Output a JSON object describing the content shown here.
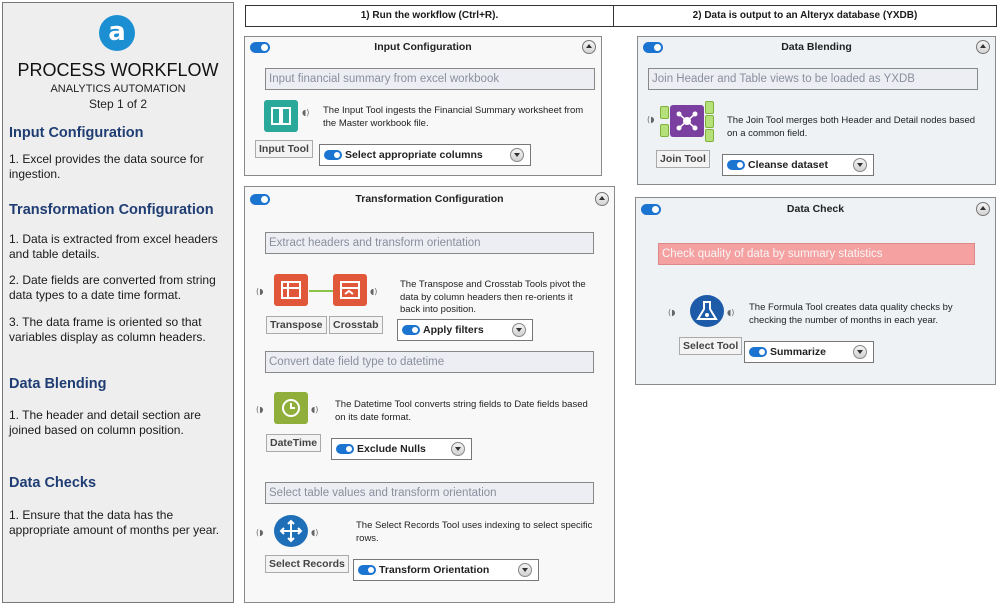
{
  "left_panel": {
    "logo_letter": "a",
    "title": "PROCESS WORKFLOW",
    "subtitle": "ANALYTICS AUTOMATION",
    "step": "Step 1 of 2",
    "sections": [
      {
        "heading": "Input Configuration",
        "items": [
          "1. Excel provides the data source for ingestion."
        ]
      },
      {
        "heading": "Transformation Configuration",
        "items": [
          "1. Data is extracted from excel headers and table details.",
          "2. Date fields are converted from string data types to a date time format.",
          "3. The data frame is oriented so that variables display as column headers."
        ]
      },
      {
        "heading": "Data Blending",
        "items": [
          "1. The header and detail section are joined based on column position."
        ]
      },
      {
        "heading": "Data Checks",
        "items": [
          "1. Ensure that the data has the appropriate amount of months per year."
        ]
      }
    ]
  },
  "steps": {
    "step1": "1) Run the workflow (Ctrl+R).",
    "step2": "2) Data is output to an Alteryx database (YXDB)"
  },
  "input_config": {
    "title": "Input Configuration",
    "banner": "Input financial summary from excel workbook",
    "tool_label": "Input Tool",
    "description": "The Input Tool ingests the Financial Summary worksheet from the Master workbook file.",
    "dropdown": "Select appropriate columns"
  },
  "transformation": {
    "title": "Transformation Configuration",
    "section1": {
      "banner": "Extract headers and transform orientation",
      "tool1_label": "Transpose",
      "tool2_label": "Crosstab",
      "description": "The Transpose and Crosstab Tools pivot the data by column headers then re-orients it back into position.",
      "dropdown": "Apply filters"
    },
    "section2": {
      "banner": "Convert date field type to datetime",
      "tool_label": "DateTime",
      "description": "The Datetime Tool converts string fields to Date fields based on its date format.",
      "dropdown": "Exclude Nulls"
    },
    "section3": {
      "banner": "Select table values and transform orientation",
      "tool_label": "Select Records",
      "description": "The Select Records Tool uses indexing to select specific rows.",
      "dropdown": "Transform Orientation"
    }
  },
  "data_blending": {
    "title": "Data Blending",
    "banner": "Join Header and Table views to be loaded as YXDB",
    "tool_label": "Join Tool",
    "description": "The Join Tool merges both Header and Detail nodes based on a common field.",
    "dropdown": "Cleanse dataset",
    "anchors": [
      "L",
      "J",
      "R"
    ]
  },
  "data_check": {
    "title": "Data Check",
    "banner": "Check quality of data by summary statistics",
    "tool_label": "Select Tool",
    "description": "The Formula Tool creates data quality checks by checking the number of months in each year.",
    "dropdown": "Summarize"
  },
  "colors": {
    "accent_blue": "#1c74d1",
    "logo_blue": "#1c8fd2",
    "heading_navy": "#1f3d73",
    "input_tool": "#2aa89a",
    "transform_tool": "#e0573a",
    "datetime_tool": "#8fae3a",
    "select_tool": "#1e6fb8",
    "join_tool": "#7b3fa0",
    "formula_tool": "#1d5aa8",
    "alert_red": "#f5a1a1"
  }
}
